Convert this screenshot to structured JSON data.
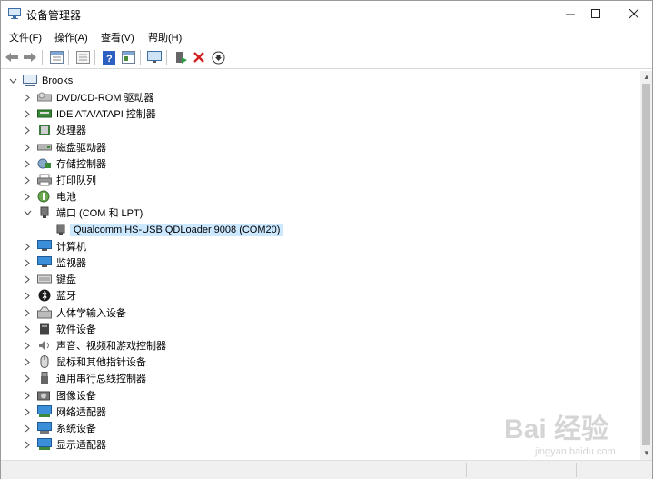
{
  "window": {
    "title": "设备管理器"
  },
  "menu": [
    "文件(F)",
    "操作(A)",
    "查看(V)",
    "帮助(H)"
  ],
  "toolbar_icons": [
    "back-icon",
    "forward-icon",
    "properties-icon",
    "show-hidden-icon",
    "help-icon",
    "view-icon",
    "monitor-icon",
    "enable-device-icon",
    "uninstall-icon",
    "update-driver-icon"
  ],
  "tree": {
    "root": "Brooks",
    "items": [
      {
        "label": "DVD/CD-ROM 驱动器",
        "icon": "dvd-drive-icon",
        "expanded": false
      },
      {
        "label": "IDE ATA/ATAPI 控制器",
        "icon": "ide-controller-icon",
        "expanded": false
      },
      {
        "label": "处理器",
        "icon": "processor-icon",
        "expanded": false
      },
      {
        "label": "磁盘驱动器",
        "icon": "disk-drive-icon",
        "expanded": false
      },
      {
        "label": "存储控制器",
        "icon": "storage-controller-icon",
        "expanded": false
      },
      {
        "label": "打印队列",
        "icon": "printer-icon",
        "expanded": false
      },
      {
        "label": "电池",
        "icon": "battery-icon",
        "expanded": false
      },
      {
        "label": "端口 (COM 和 LPT)",
        "icon": "port-icon",
        "expanded": true,
        "children": [
          {
            "label": "Qualcomm HS-USB QDLoader 9008 (COM20)",
            "icon": "port-device-icon",
            "selected": true
          }
        ]
      },
      {
        "label": "计算机",
        "icon": "computer-icon",
        "expanded": false
      },
      {
        "label": "监视器",
        "icon": "monitor-icon",
        "expanded": false
      },
      {
        "label": "键盘",
        "icon": "keyboard-icon",
        "expanded": false
      },
      {
        "label": "蓝牙",
        "icon": "bluetooth-icon",
        "expanded": false
      },
      {
        "label": "人体学输入设备",
        "icon": "hid-icon",
        "expanded": false
      },
      {
        "label": "软件设备",
        "icon": "software-device-icon",
        "expanded": false
      },
      {
        "label": "声音、视频和游戏控制器",
        "icon": "sound-icon",
        "expanded": false
      },
      {
        "label": "鼠标和其他指针设备",
        "icon": "mouse-icon",
        "expanded": false
      },
      {
        "label": "通用串行总线控制器",
        "icon": "usb-icon",
        "expanded": false
      },
      {
        "label": "图像设备",
        "icon": "camera-icon",
        "expanded": false
      },
      {
        "label": "网络适配器",
        "icon": "network-adapter-icon",
        "expanded": false
      },
      {
        "label": "系统设备",
        "icon": "system-device-icon",
        "expanded": false
      },
      {
        "label": "显示适配器",
        "icon": "display-adapter-icon",
        "expanded": false
      }
    ]
  },
  "watermark": {
    "main": "Bai 经验",
    "sub": "jingyan.baidu.com"
  }
}
